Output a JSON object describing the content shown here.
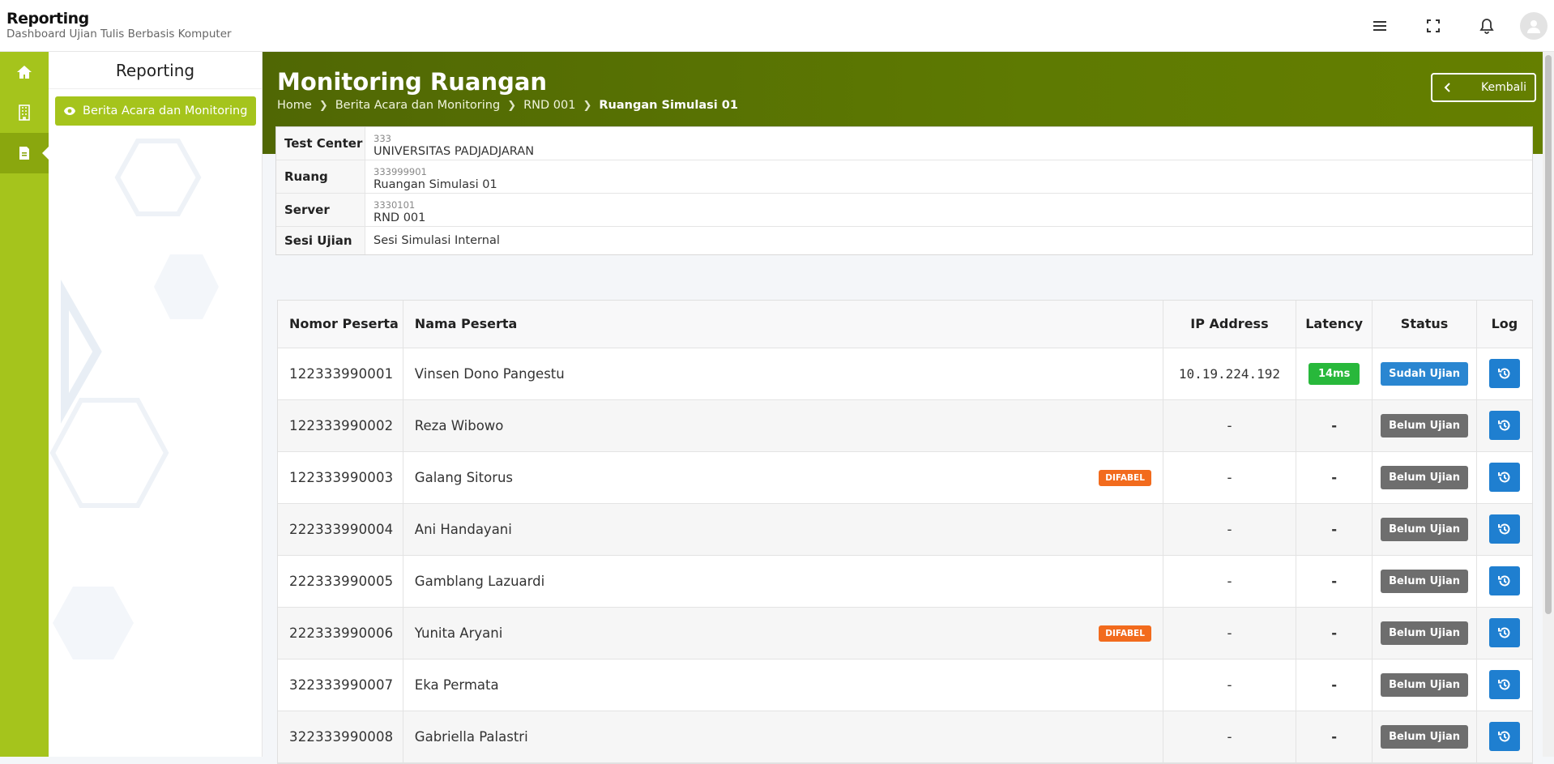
{
  "header": {
    "title": "Reporting",
    "subtitle": "Dashboard Ujian Tulis Berbasis Komputer",
    "icons": [
      "menu-icon",
      "fullscreen-icon",
      "bell-icon",
      "user-avatar-icon"
    ]
  },
  "rail": {
    "items": [
      {
        "icon": "home-icon"
      },
      {
        "icon": "building-icon"
      },
      {
        "icon": "report-icon",
        "active": true
      }
    ]
  },
  "subnav": {
    "title": "Reporting",
    "button_label": "Berita Acara dan Monitoring"
  },
  "page": {
    "title": "Monitoring Ruangan",
    "breadcrumb": [
      "Home",
      "Berita Acara dan Monitoring",
      "RND 001",
      "Ruangan Simulasi 01"
    ],
    "back_label": "Kembali"
  },
  "info": {
    "test_center": {
      "label": "Test Center",
      "code": "333",
      "value": "UNIVERSITAS PADJADJARAN"
    },
    "ruang": {
      "label": "Ruang",
      "code": "333999901",
      "value": "Ruangan Simulasi 01"
    },
    "server": {
      "label": "Server",
      "code": "3330101",
      "value": "RND 001"
    },
    "sesi": {
      "label": "Sesi Ujian",
      "value": "Sesi Simulasi Internal"
    }
  },
  "table": {
    "headers": [
      "Nomor Peserta",
      "Nama Peserta",
      "IP Address",
      "Latency",
      "Status",
      "Log"
    ],
    "rows": [
      {
        "nomor": "122333990001",
        "nama": "Vinsen Dono Pangestu",
        "difabel": "",
        "ip": "10.19.224.192",
        "latency": "14ms",
        "status": "Sudah Ujian"
      },
      {
        "nomor": "122333990002",
        "nama": "Reza Wibowo",
        "difabel": "",
        "ip": "-",
        "latency": "-",
        "status": "Belum Ujian"
      },
      {
        "nomor": "122333990003",
        "nama": "Galang Sitorus",
        "difabel": "DIFABEL",
        "ip": "-",
        "latency": "-",
        "status": "Belum Ujian"
      },
      {
        "nomor": "222333990004",
        "nama": "Ani Handayani",
        "difabel": "",
        "ip": "-",
        "latency": "-",
        "status": "Belum Ujian"
      },
      {
        "nomor": "222333990005",
        "nama": "Gamblang Lazuardi",
        "difabel": "",
        "ip": "-",
        "latency": "-",
        "status": "Belum Ujian"
      },
      {
        "nomor": "222333990006",
        "nama": "Yunita Aryani",
        "difabel": "DIFABEL",
        "ip": "-",
        "latency": "-",
        "status": "Belum Ujian"
      },
      {
        "nomor": "322333990007",
        "nama": "Eka Permata",
        "difabel": "",
        "ip": "-",
        "latency": "-",
        "status": "Belum Ujian"
      },
      {
        "nomor": "322333990008",
        "nama": "Gabriella Palastri",
        "difabel": "",
        "ip": "-",
        "latency": "-",
        "status": "Belum Ujian"
      }
    ]
  },
  "colors": {
    "rail": "#a5c41c",
    "banner": "#5e7a02",
    "latency_good": "#28b83b",
    "status_done": "#2a86d1",
    "status_not": "#6e6e6e",
    "difabel": "#f26b1d",
    "log_button": "#1f7fd0"
  }
}
